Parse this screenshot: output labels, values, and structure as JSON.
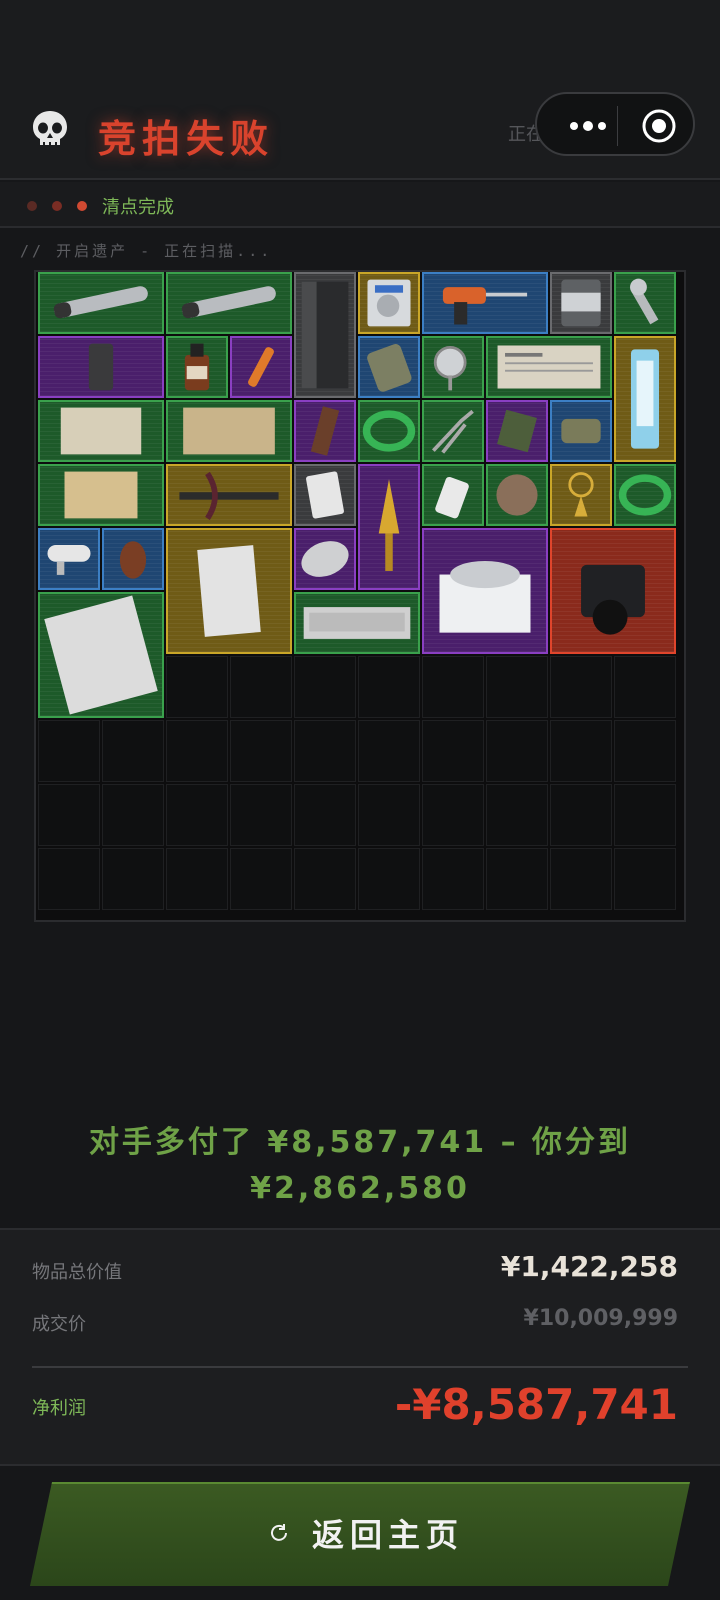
{
  "header": {
    "title": "竞拍失败",
    "restore_text": "正在还原遗产情...",
    "skull_icon": "skull-icon"
  },
  "status": {
    "text": "清点完成"
  },
  "scan_text": "// 开启遗产 - 正在扫描...",
  "grid": {
    "items": [
      {
        "name": "tube-item",
        "rarity": "green"
      },
      {
        "name": "tube-item-2",
        "rarity": "green"
      },
      {
        "name": "armor-plate-item",
        "rarity": "gray"
      },
      {
        "name": "hdd-item",
        "rarity": "gold"
      },
      {
        "name": "drill-item",
        "rarity": "blue"
      },
      {
        "name": "can-item",
        "rarity": "gray"
      },
      {
        "name": "wrench-item",
        "rarity": "green"
      },
      {
        "name": "plate-item",
        "rarity": "purple"
      },
      {
        "name": "bottle-item",
        "rarity": "green"
      },
      {
        "name": "tube-orange-item",
        "rarity": "purple"
      },
      {
        "name": "bag-item",
        "rarity": "blue"
      },
      {
        "name": "gauge-item",
        "rarity": "green"
      },
      {
        "name": "newspaper-item",
        "rarity": "green"
      },
      {
        "name": "syringe-item",
        "rarity": "gold"
      },
      {
        "name": "old-paper-item",
        "rarity": "green"
      },
      {
        "name": "map-item",
        "rarity": "green"
      },
      {
        "name": "snack-item",
        "rarity": "purple"
      },
      {
        "name": "green-cable-item",
        "rarity": "green"
      },
      {
        "name": "pliers-item",
        "rarity": "green"
      },
      {
        "name": "circuit-item",
        "rarity": "purple"
      },
      {
        "name": "tin-can-item",
        "rarity": "blue"
      },
      {
        "name": "letters-item",
        "rarity": "green"
      },
      {
        "name": "crossbow-item",
        "rarity": "gold"
      },
      {
        "name": "card-item",
        "rarity": "gray"
      },
      {
        "name": "gold-dagger-item",
        "rarity": "purple"
      },
      {
        "name": "glue-item",
        "rarity": "green"
      },
      {
        "name": "coin-item",
        "rarity": "green"
      },
      {
        "name": "pendant-item",
        "rarity": "gold"
      },
      {
        "name": "green-cable-item-2",
        "rarity": "green"
      },
      {
        "name": "camera-item",
        "rarity": "blue"
      },
      {
        "name": "bird-statue-item",
        "rarity": "blue"
      },
      {
        "name": "clipboard-item",
        "rarity": "gold"
      },
      {
        "name": "egg-item",
        "rarity": "purple"
      },
      {
        "name": "centrifuge-item",
        "rarity": "purple"
      },
      {
        "name": "video-camera-item",
        "rarity": "red"
      },
      {
        "name": "magazine-item",
        "rarity": "green"
      },
      {
        "name": "keyboard-item",
        "rarity": "green"
      }
    ]
  },
  "result_message": {
    "line1": "对手多付了 ¥8,587,741 – 你分到",
    "line2": "¥2,862,580"
  },
  "summary": {
    "total_label": "物品总价值",
    "total_value": "¥1,422,258",
    "deal_label": "成交价",
    "deal_value": "¥10,009,999",
    "profit_label": "净利润",
    "profit_value": "-¥8,587,741"
  },
  "button": {
    "label": "返回主页",
    "icon": "refresh-icon"
  },
  "colors": {
    "danger": "#d9432d",
    "success": "#6fa247",
    "status": "#7eb858"
  }
}
